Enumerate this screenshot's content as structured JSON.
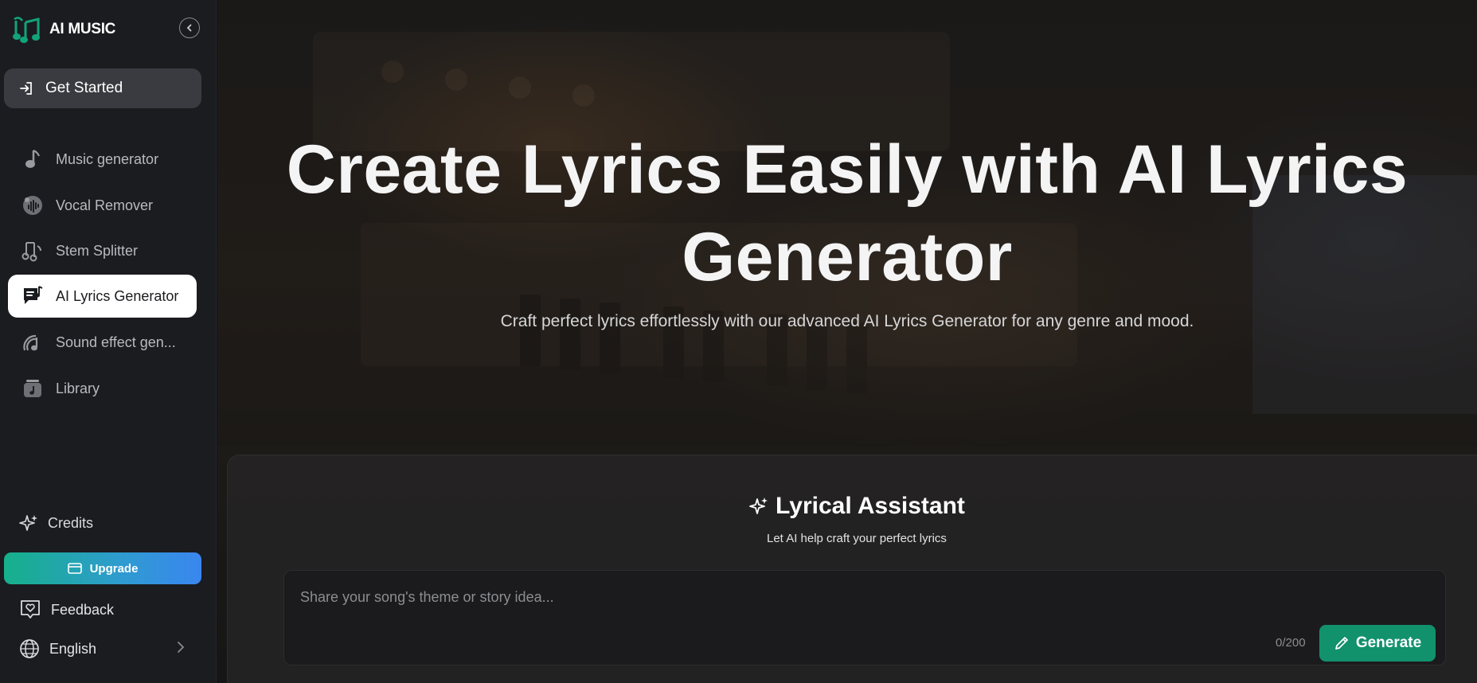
{
  "brand": {
    "name": "AI MUSIC",
    "accent": "#12a37a"
  },
  "sidebar": {
    "get_started": "Get Started",
    "items": [
      {
        "label": "Music generator",
        "icon": "music-note-icon"
      },
      {
        "label": "Vocal Remover",
        "icon": "vocal-remover-icon"
      },
      {
        "label": "Stem Splitter",
        "icon": "stem-splitter-icon"
      },
      {
        "label": "AI Lyrics Generator",
        "icon": "lyrics-icon",
        "active": true
      },
      {
        "label": "Sound effect gen...",
        "icon": "sound-effect-icon"
      },
      {
        "label": "Library",
        "icon": "library-icon"
      }
    ],
    "credits": "Credits",
    "upgrade": "Upgrade",
    "feedback": "Feedback",
    "language": "English"
  },
  "hero": {
    "title_line1": "Create Lyrics Easily with AI Lyrics",
    "title_line2": "Generator",
    "subtitle": "Craft perfect lyrics effortlessly with our advanced AI Lyrics Generator for any genre and mood."
  },
  "assistant": {
    "title": "Lyrical Assistant",
    "subtitle": "Let AI help craft your perfect lyrics",
    "placeholder": "Share your song's theme or story idea...",
    "counter": "0/200",
    "generate": "Generate"
  }
}
